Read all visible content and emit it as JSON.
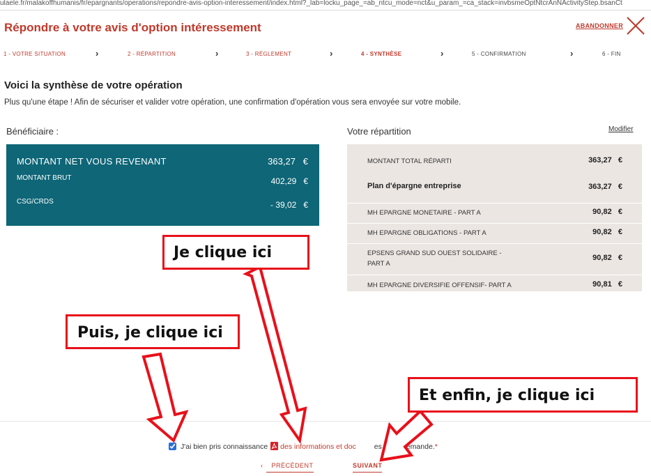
{
  "url": "ulaele.fr/malakoffhumanis/fr/epargnants/operations/repondre-avis-option-interessement/index.html?_lab=locku_page_=ab_ntcu_mode=nct&u_param_=ca_stack=invbsmeOptNtcrAnNActivityStep.bsanCt",
  "title": "Répondre à votre avis d'option intéressement",
  "abandon": "ABANDONNER",
  "steps": [
    "1 - VOTRE SITUATION",
    "2 - RÉPARTITION",
    "3 - RÈGLEMENT",
    "4 - SYNTHÈSE",
    "5 - CONFIRMATION",
    "6 - FIN"
  ],
  "chevron": "›",
  "heading": "Voici la synthèse de votre opération",
  "subtitle": "Plus qu'une étape ! Afin de sécuriser et valider votre opération, une confirmation d'opération vous sera envoyée sur votre mobile.",
  "beneficiary": {
    "label": "Bénéficiaire :",
    "net_label": "MONTANT NET VOUS REVENANT",
    "net_amount": "363,27   €",
    "gross_label": "MONTANT BRUT",
    "gross_amount": "402,29   €",
    "csg_label": "CSG/CRDS",
    "csg_amount": "- 39,02   €"
  },
  "repartition": {
    "label": "Votre répartition",
    "modify": "Modifier",
    "total_label": "MONTANT TOTAL RÉPARTI",
    "total_amount": "363,27   €",
    "plan_label": "Plan d'épargne entreprise",
    "plan_amount": "363,27   €",
    "funds": [
      {
        "name": "MH EPARGNE MONETAIRE - PART A",
        "amount": "90,82   €"
      },
      {
        "name": "MH EPARGNE OBLIGATIONS - PART A",
        "amount": "90,82   €"
      },
      {
        "name": "EPSENS GRAND SUD OUEST SOLIDAIRE -",
        "name2": "PART A",
        "amount": "90,82   €"
      },
      {
        "name": "MH EPARGNE DIVERSIFIE OFFENSIF- PART A",
        "amount": "90,81   €"
      }
    ]
  },
  "consent": {
    "prefix": "J'ai bien pris connaissance",
    "link": "des informations et doc",
    "suffix": "es à ma demande.",
    "required": "*"
  },
  "nav": {
    "previous": "PRÉCÉDENT",
    "next": "SUIVANT"
  },
  "callouts": {
    "first": "Je clique ici",
    "second": "Puis, je clique ici",
    "third": "Et enfin, je clique ici"
  },
  "colors": {
    "brand": "#c0392b",
    "teal": "#0e6677",
    "callout_border": "#e8101a"
  }
}
